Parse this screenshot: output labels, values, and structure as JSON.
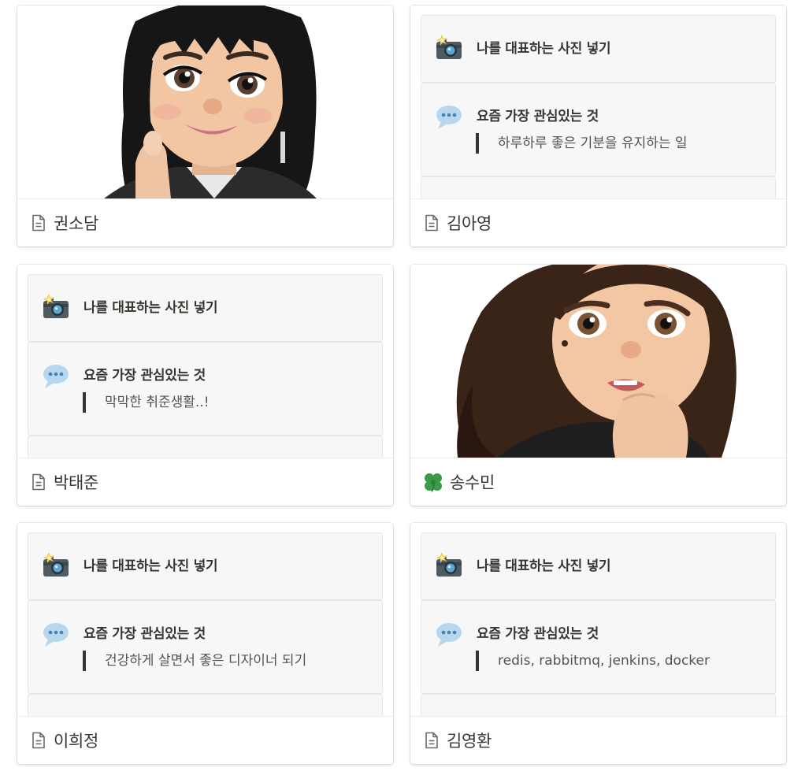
{
  "block_labels": {
    "photo": "나를 대표하는 사진 넣기",
    "interest": "요즘 가장 관심있는 것"
  },
  "cards": [
    {
      "title": "권소담",
      "icon": "page-icon",
      "cover": "avatar-photo"
    },
    {
      "title": "김아영",
      "icon": "page-icon",
      "interest": "하루하루 좋은 기분을 유지하는 일"
    },
    {
      "title": "박태준",
      "icon": "page-icon",
      "interest": "막막한 취준생활..!"
    },
    {
      "title": "송수민",
      "icon": "four-leaf-clover-icon",
      "cover": "avatar-photo"
    },
    {
      "title": "이희정",
      "icon": "page-icon",
      "interest": "건강하게 살면서 좋은 디자이너 되기"
    },
    {
      "title": "김영환",
      "icon": "page-icon",
      "interest": "redis, rabbitmq, jenkins, docker"
    }
  ],
  "colors": {
    "text": "#37352f",
    "block_bg": "#f7f7f7",
    "clover": "#3d9a4a"
  }
}
